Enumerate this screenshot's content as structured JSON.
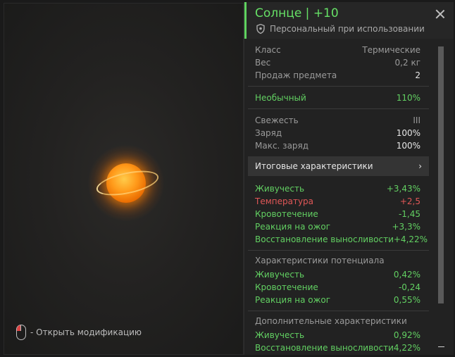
{
  "preview": {
    "hint": "- Открыть модификацию"
  },
  "header": {
    "title": "Солнце | +10",
    "subtitle": "Персональный при использовании"
  },
  "info": [
    {
      "label": "Класс",
      "value": "Термические"
    },
    {
      "label": "Вес",
      "value": "0,2 кг"
    },
    {
      "label": "Продаж предмета",
      "value": "2"
    }
  ],
  "rarity": {
    "label": "Необычный",
    "value": "110%"
  },
  "state": [
    {
      "label": "Свежесть",
      "value": "III"
    },
    {
      "label": "Заряд",
      "value": "100%"
    },
    {
      "label": "Макс. заряд",
      "value": "100%"
    }
  ],
  "summary": {
    "label": "Итоговые характеристики",
    "arrow": "›"
  },
  "final_stats": [
    {
      "label": "Живучесть",
      "value": "+3,43%",
      "color": "green"
    },
    {
      "label": "Температура",
      "value": "+2,5",
      "color": "red"
    },
    {
      "label": "Кровотечение",
      "value": "-1,45",
      "color": "green"
    },
    {
      "label": "Реакция на ожог",
      "value": "+3,3%",
      "color": "green"
    },
    {
      "label": "Восстановление выносливости",
      "value": "+4,22%",
      "color": "green"
    }
  ],
  "potential": {
    "title": "Характеристики потенциала",
    "items": [
      {
        "label": "Живучесть",
        "value": "0,42%"
      },
      {
        "label": "Кровотечение",
        "value": "-0,24"
      },
      {
        "label": "Реакция на ожог",
        "value": "0,55%"
      }
    ]
  },
  "extra": {
    "title": "Дополнительные характеристики",
    "items": [
      {
        "label": "Живучесть",
        "value": "0,92%"
      },
      {
        "label": "Восстановление выносливости",
        "value": "4,22%"
      }
    ]
  },
  "colors": {
    "accent": "#5fd35f",
    "green": "#62d062",
    "red": "#e05757"
  }
}
